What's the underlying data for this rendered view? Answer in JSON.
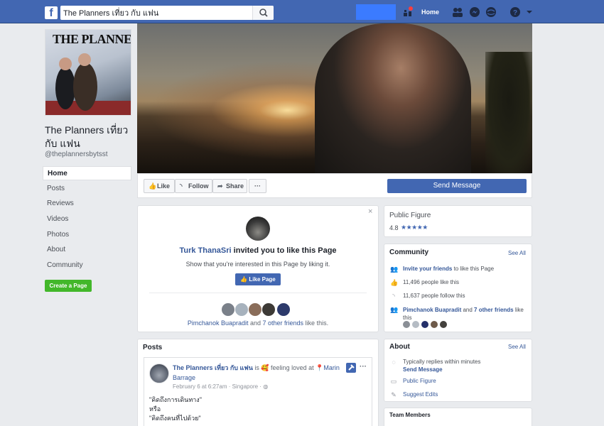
{
  "topbar": {
    "logo": "f",
    "search_value": "The Planners เที่ยว กับ แฟน",
    "home_label": "Home",
    "colors": {
      "bar": "#4267b2",
      "profile_block": "#3b7bff"
    }
  },
  "profile": {
    "picture_text": "THE PLANNERS",
    "name": "The Planners เที่ยว กับ แฟน",
    "handle": "@theplannersbytsst"
  },
  "nav": {
    "items": [
      {
        "label": "Home",
        "active": true
      },
      {
        "label": "Posts"
      },
      {
        "label": "Reviews"
      },
      {
        "label": "Videos"
      },
      {
        "label": "Photos"
      },
      {
        "label": "About"
      },
      {
        "label": "Community"
      }
    ],
    "create_page": "Create a Page"
  },
  "actions": {
    "like": "Like",
    "follow": "Follow",
    "share": "Share",
    "more": "···",
    "send_message": "Send Message"
  },
  "invite": {
    "close": "×",
    "inviter": "Turk ThanaSri",
    "title_rest": " invited you to like this Page",
    "subtitle": "Show that you're interested in this Page by liking it.",
    "like_button": "Like Page",
    "friend_name": "Pimchanok Buapradit",
    "friends_mid": " and ",
    "friends_count": "7 other friends",
    "friends_end": " like this."
  },
  "posts": {
    "title": "Posts",
    "author": "The Planners เที่ยว กับ แฟน",
    "action_text": " is 🥰 feeling loved at ",
    "location_a": "Marin",
    "location_b": "Barrage",
    "meta": "February 6 at 6:27am · Singapore · ",
    "more": "···",
    "lines": [
      "\"คิดถึงการเดินทาง\"",
      "หรือ",
      "\"คิดถึงคนที่ไปด้วย\""
    ]
  },
  "public_figure": {
    "title": "Public Figure",
    "rating": "4.8",
    "stars": "★★★★★"
  },
  "community": {
    "title": "Community",
    "see_all": "See All",
    "invite_link": "Invite your friends",
    "invite_rest": " to like this Page",
    "likes": "11,496 people like this",
    "follows": "11,637 people follow this",
    "friend_name": "Pimchanok Buapradit",
    "friend_mid": " and ",
    "friend_count": "7 other friends",
    "friend_end": " like this"
  },
  "about": {
    "title": "About",
    "see_all": "See All",
    "reply_text": "Typically replies within minutes",
    "send_message": "Send Message",
    "category": "Public Figure",
    "suggest": "Suggest Edits"
  },
  "team": {
    "title": "Team Members"
  }
}
